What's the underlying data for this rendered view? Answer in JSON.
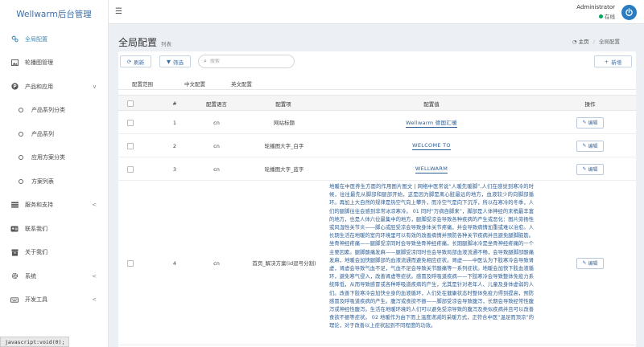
{
  "brand": "Wellwarm后台管理",
  "sidebar": {
    "items": [
      {
        "label": "全局配置",
        "icon": "gears-icon",
        "chev": ""
      },
      {
        "label": "轮播图管理",
        "icon": "image-icon",
        "chev": ""
      },
      {
        "label": "产品和应用",
        "icon": "product-hunt-icon",
        "chev": "∨"
      },
      {
        "label": "产品系列分类",
        "icon": "circle-icon",
        "chev": ""
      },
      {
        "label": "产品系列",
        "icon": "circle-icon",
        "chev": ""
      },
      {
        "label": "应用方案分类",
        "icon": "circle-icon",
        "chev": ""
      },
      {
        "label": "方案列表",
        "icon": "circle-icon",
        "chev": ""
      },
      {
        "label": "服务和支持",
        "icon": "list-icon",
        "chev": "<"
      },
      {
        "label": "联系我们",
        "icon": "id-card-icon",
        "chev": ""
      },
      {
        "label": "关于我们",
        "icon": "archive-icon",
        "chev": ""
      },
      {
        "label": "系统",
        "icon": "cog-icon",
        "chev": "<"
      },
      {
        "label": "开发工具",
        "icon": "keyboard-icon",
        "chev": "<"
      }
    ]
  },
  "topbar": {
    "menu_icon": "☰",
    "username": "Administrator",
    "status": "在线"
  },
  "page": {
    "title": "全局配置",
    "subtitle": "列表",
    "breadcrumb_home": "主页",
    "breadcrumb_sep": "/",
    "breadcrumb_current": "全局配置"
  },
  "toolbar": {
    "refresh": "刷新",
    "filter": "筛选",
    "search_placeholder": "搜索",
    "add": "新增"
  },
  "tabs": [
    "配置范围",
    "中文配置",
    "英文配置"
  ],
  "table": {
    "headers": {
      "num": "#",
      "lang": "配置语言",
      "item": "配置项",
      "value": "配置值",
      "action": "操作"
    },
    "edit_label": "编辑",
    "rows": [
      {
        "num": "1",
        "lang": "cn",
        "item": "网站标题",
        "value": "Wellwarm 德国汇暖"
      },
      {
        "num": "2",
        "lang": "cn",
        "item": "轮播图大字_白字",
        "value": "WELCOME TO"
      },
      {
        "num": "3",
        "lang": "cn",
        "item": "轮播图大字_蓝字",
        "value": "WELLWARM"
      },
      {
        "num": "4",
        "lang": "cn",
        "item": "首页_解决方案(id逗号分割)",
        "value": "地暖在中医养生方面的作用图片图文 | 网络中医常说“人暖先暖脚”,人们在感觉到寒冷的时候，往往最先从脚部和腿部开始，这是因为脚是离心脏最远的地方，血液较少的向脚部循环。再加上大自然的规律是热空气向上攀升，而冷空气是向下沉浮，所以在寒冷的冬季，人们的腿脚往往会感到非常冰凉寒冷。 01 同时“万病自脚来”，脚部是人体神经的末梢最丰富的地方，也是人体六位最集中的地方，腿脚受凉会导致各种疾病的产生或恶化：图片旁扬性或风湿性关节炎——脚心或胫受凉会导致身体关节疼痛，并会导致病情加重或难以治愈。人长期生活在地暖的室内环境里可以有效的改善病情并预防各种关节疾病并且避免腿脚脑筋。坐骨神经疼痛——腿脚受凉同时会导致坐骨神经疼痛，长期腿脚冰冷是坐骨神经疼痛的一个主要因素。腿脚酸痛发麻——腿脚受凉同时也会导致局部血液流通不畅，会导致腿脚部酸痛发麻，地暖会加快腿脚部的血液流通而避免相应症状。肾虚——中医认为下肢寒冷会导致肾虚，肾虚会导致气血不足，气血不足会导致关节酸痛等一系列症状。地暖会加快下肢血液循环，避免寒气侵入，改善肾虚等症状。感冒及呼吸道疾病——下肢寒冷会导致整体免疫力系统降低，从而导致感冒或各种呼吸道疾病的产生，尤其是针对老年人、儿童及身体虚弱的人们。改善下肢寒冷会加快全身的血液循环，人们处在健康状态时整体免疫力得到提高，预防感冒及呼吸道疾病的产生。腹泻或食欲不振——脚部受凉会导致腹泻，长期会导致经常性腹泻或神经性腹泻。生活在地暖环境的人们可以避免受凉导致的腹泻及类似疾病并且可以改善食欲不振等症状。 02 地暖作为由下而上温度递减的采暖方式，正符合中医“温足而顶凉”的理论，对于改善以上症状起到不同程度的功效。"
      }
    ]
  },
  "statusbar": "javascript:void(0);"
}
